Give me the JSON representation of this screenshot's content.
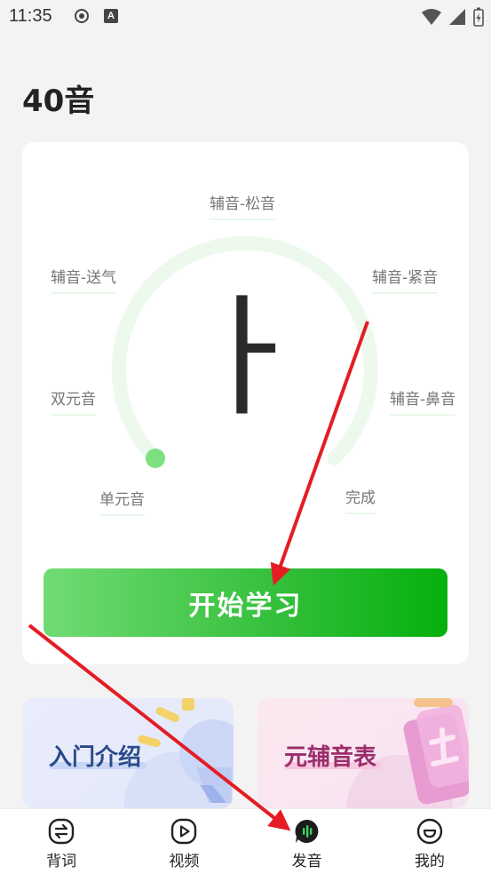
{
  "status_bar": {
    "time": "11:35",
    "a_badge": "A"
  },
  "page": {
    "title": "40音"
  },
  "stages": {
    "songyin": "辅音-松音",
    "songqi": "辅音-送气",
    "jinyin": "辅音-紧音",
    "shuang": "双元音",
    "biyin": "辅音-鼻音",
    "danyuan": "单元音",
    "wancheng": "完成"
  },
  "current_char": "ㅏ",
  "start_button": {
    "label": "开始学习"
  },
  "features": {
    "intro": {
      "label": "入门介绍"
    },
    "table": {
      "label": "元辅音表"
    }
  },
  "tabs": [
    {
      "label": "背词",
      "icon": "swap-icon"
    },
    {
      "label": "视频",
      "icon": "video-play-icon"
    },
    {
      "label": "发音",
      "icon": "voice-bubble-icon"
    },
    {
      "label": "我的",
      "icon": "profile-smile-icon"
    }
  ],
  "colors": {
    "accent": "#05b00d",
    "arrow": "#e51c23"
  }
}
